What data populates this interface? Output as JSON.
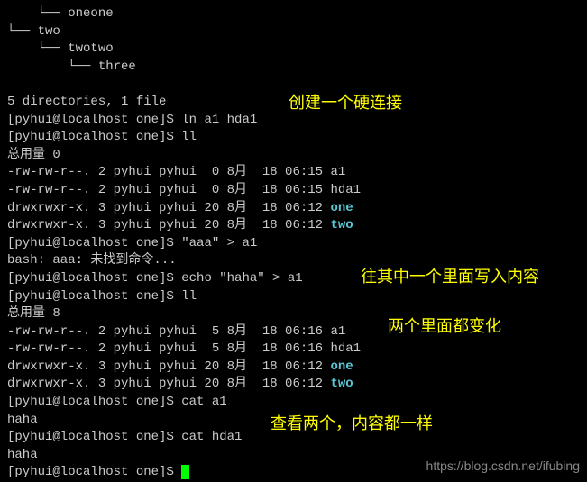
{
  "tree": {
    "l1": "    └── oneone",
    "l2": "└── two",
    "l3": "    └── twotwo",
    "l4": "        └── three"
  },
  "blank": " ",
  "summary": "5 directories, 1 file",
  "p1_prompt": "[pyhui@localhost one]$ ",
  "p1_cmd": "ln a1 hda1",
  "p2_prompt": "[pyhui@localhost one]$ ",
  "p2_cmd": "ll",
  "total0": "总用量 0",
  "ls1_a1": "-rw-rw-r--. 2 pyhui pyhui  0 8月  18 06:15 a1",
  "ls1_hda1": "-rw-rw-r--. 2 pyhui pyhui  0 8月  18 06:15 hda1",
  "ls1_one_pre": "drwxrwxr-x. 3 pyhui pyhui 20 8月  18 06:12 ",
  "ls1_one_dir": "one",
  "ls1_two_pre": "drwxrwxr-x. 3 pyhui pyhui 20 8月  18 06:12 ",
  "ls1_two_dir": "two",
  "p3_prompt": "[pyhui@localhost one]$ ",
  "p3_cmd": "\"aaa\" > a1",
  "bash_err": "bash: aaa: 未找到命令...",
  "p4_prompt": "[pyhui@localhost one]$ ",
  "p4_cmd": "echo \"haha\" > a1",
  "p5_prompt": "[pyhui@localhost one]$ ",
  "p5_cmd": "ll",
  "total8": "总用量 8",
  "ls2_a1": "-rw-rw-r--. 2 pyhui pyhui  5 8月  18 06:16 a1",
  "ls2_hda1": "-rw-rw-r--. 2 pyhui pyhui  5 8月  18 06:16 hda1",
  "ls2_one_pre": "drwxrwxr-x. 3 pyhui pyhui 20 8月  18 06:12 ",
  "ls2_one_dir": "one",
  "ls2_two_pre": "drwxrwxr-x. 3 pyhui pyhui 20 8月  18 06:12 ",
  "ls2_two_dir": "two",
  "p6_prompt": "[pyhui@localhost one]$ ",
  "p6_cmd": "cat a1",
  "out_haha1": "haha",
  "p7_prompt": "[pyhui@localhost one]$ ",
  "p7_cmd": "cat hda1",
  "out_haha2": "haha",
  "p8_prompt": "[pyhui@localhost one]$ ",
  "annotations": {
    "a1": "创建一个硬连接",
    "a2": "往其中一个里面写入内容",
    "a3": "两个里面都变化",
    "a4": "查看两个，内容都一样"
  },
  "watermark": "https://blog.csdn.net/ifubing"
}
